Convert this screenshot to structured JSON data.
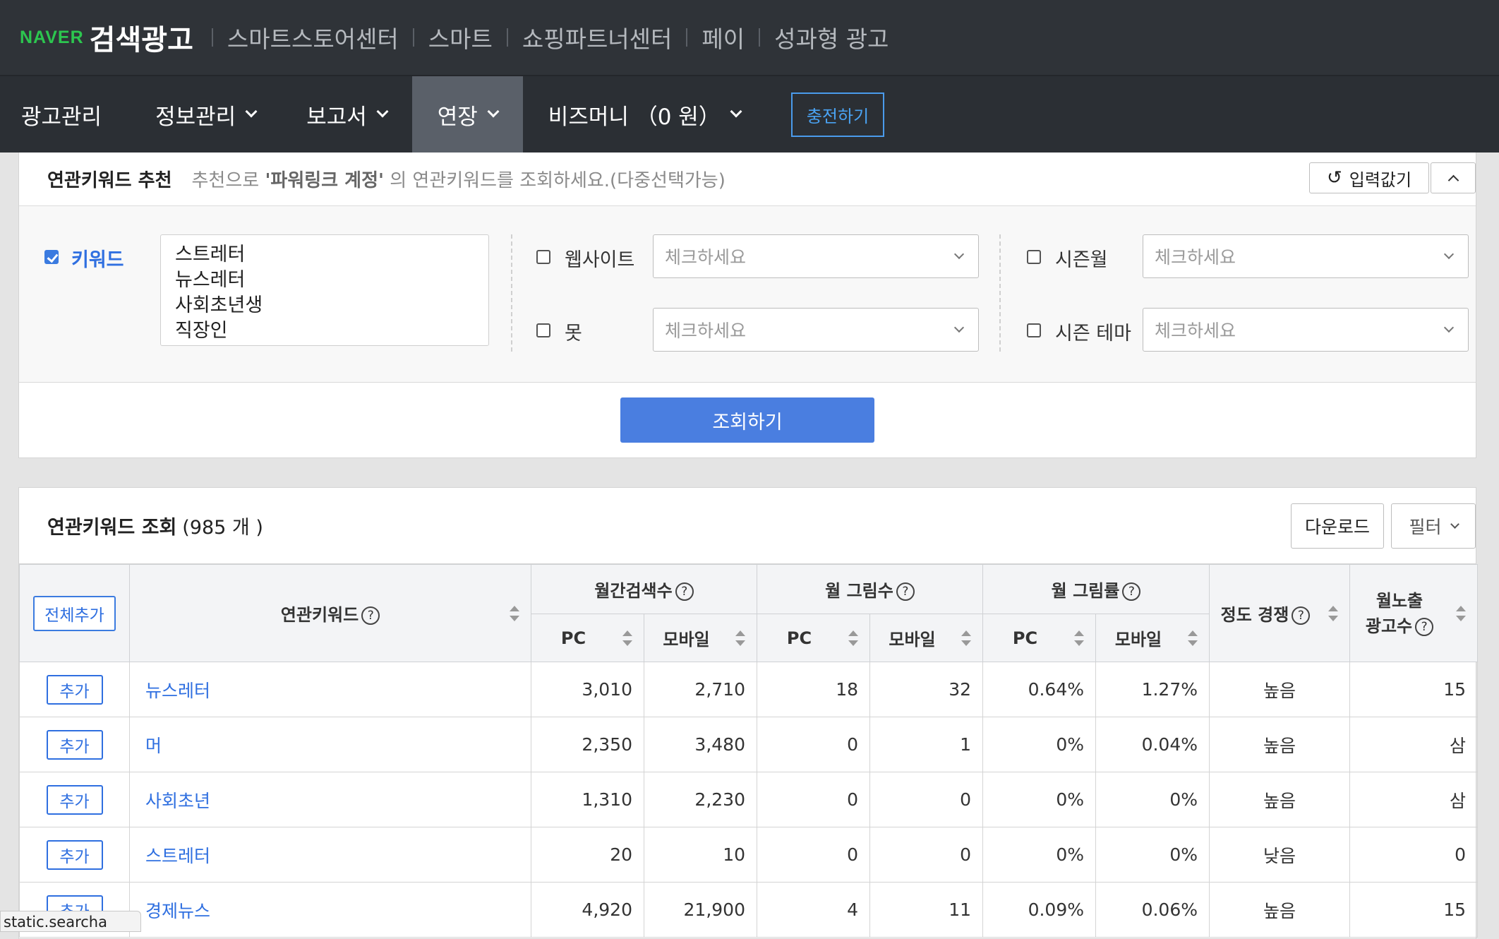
{
  "topbar": {
    "logo_naver": "NAVER",
    "logo_service": "검색광고",
    "links": [
      "스마트스토어센터",
      "스마트",
      "쇼핑파트너센터",
      "페이",
      "성과형 광고"
    ]
  },
  "nav": {
    "items": [
      {
        "label": "광고관리",
        "dropdown": false
      },
      {
        "label": "정보관리",
        "dropdown": true
      },
      {
        "label": "보고서",
        "dropdown": true
      },
      {
        "label": "연장",
        "dropdown": true,
        "active": true
      },
      {
        "label": "비즈머니 （0 원）",
        "dropdown": true
      }
    ],
    "charge_label": "충전하기"
  },
  "recommend": {
    "title": "연관키워드 추천",
    "desc_prefix": "추천으로",
    "desc_bold": "'파워링크 계정'",
    "desc_suffix": "의 연관키워드를 조회하세요.(다중선택가능)",
    "reset_label": "입력값기",
    "keyword_label": "키워드",
    "keyword_checked": true,
    "keywords_text": "스트레터\n뉴스레터\n사회초년생\n직장인",
    "website_label": "웹사이트",
    "mot_label": "못",
    "season_month_label": "시즌월",
    "season_theme_label": "시즌 테마",
    "select_placeholder": "체크하세요",
    "search_label": "조회하기"
  },
  "results": {
    "title": "연관키워드 조회",
    "count": "(985 개 )",
    "download_label": "다운로드",
    "filter_label": "필터",
    "add_all_label": "전체추가",
    "headers": {
      "keyword": "연관키워드",
      "monthly_search": "월간검색수",
      "monthly_clicks": "월 그림수",
      "monthly_ctr": "월 그림률",
      "competition": "정도 경쟁",
      "ads_line1": "월노출",
      "ads_line2": "광고수",
      "pc": "PC",
      "mobile": "모바일"
    },
    "add_label": "추가",
    "rows": [
      {
        "keyword": "뉴스레터",
        "search_pc": "3,010",
        "search_mo": "2,710",
        "click_pc": "18",
        "click_mo": "32",
        "ctr_pc": "0.64%",
        "ctr_mo": "1.27%",
        "comp": "높음",
        "ads": "15"
      },
      {
        "keyword": "머",
        "search_pc": "2,350",
        "search_mo": "3,480",
        "click_pc": "0",
        "click_mo": "1",
        "ctr_pc": "0%",
        "ctr_mo": "0.04%",
        "comp": "높음",
        "ads": "삼"
      },
      {
        "keyword": "사회초년",
        "search_pc": "1,310",
        "search_mo": "2,230",
        "click_pc": "0",
        "click_mo": "0",
        "ctr_pc": "0%",
        "ctr_mo": "0%",
        "comp": "높음",
        "ads": "삼"
      },
      {
        "keyword": "스트레터",
        "search_pc": "20",
        "search_mo": "10",
        "click_pc": "0",
        "click_mo": "0",
        "ctr_pc": "0%",
        "ctr_mo": "0%",
        "comp": "낮음",
        "ads": "0"
      },
      {
        "keyword": "경제뉴스",
        "search_pc": "4,920",
        "search_mo": "21,900",
        "click_pc": "4",
        "click_mo": "11",
        "ctr_pc": "0.09%",
        "ctr_mo": "0.06%",
        "comp": "높음",
        "ads": "15"
      }
    ]
  },
  "status_tooltip": "static.searcha"
}
